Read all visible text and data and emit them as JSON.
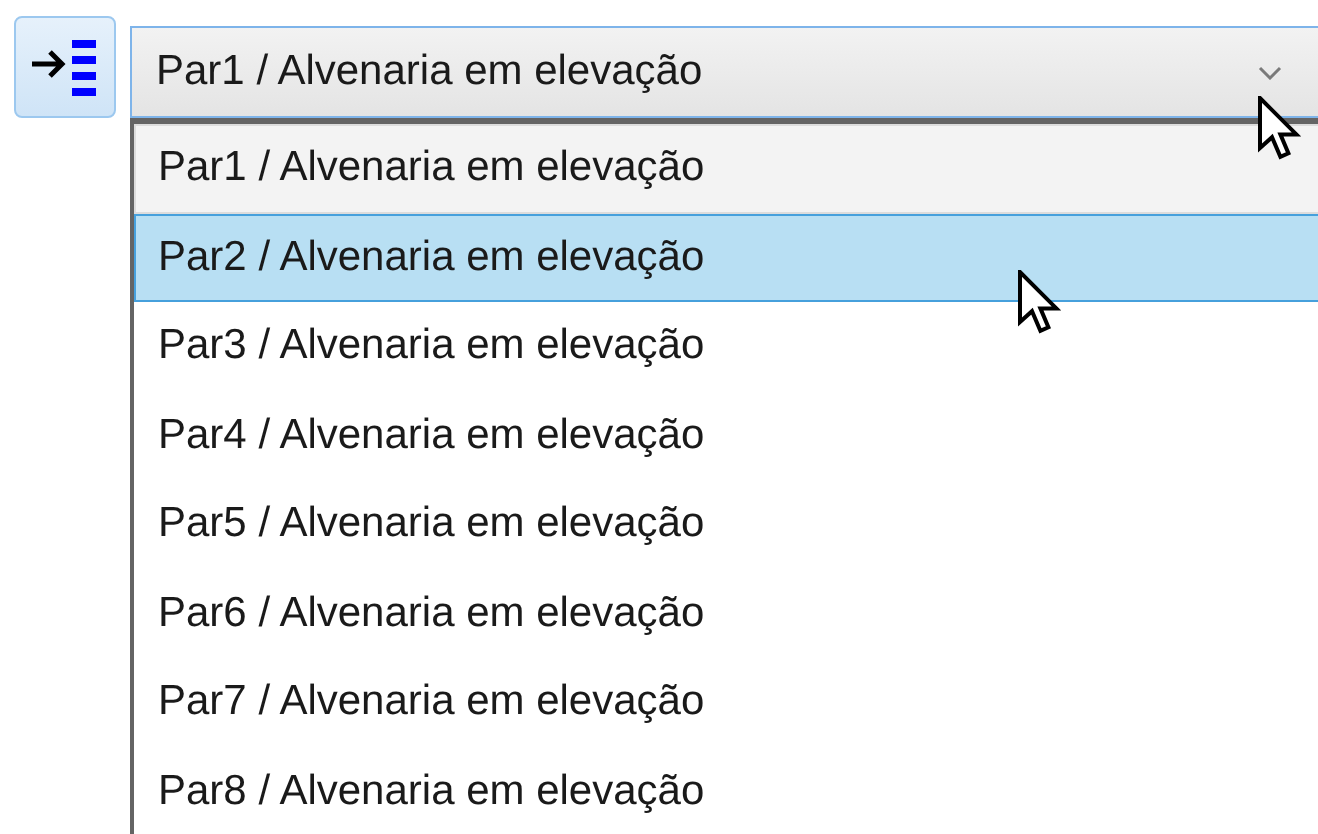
{
  "combo": {
    "value": "Par1 / Alvenaria em elevação",
    "expanded": true
  },
  "options": [
    {
      "label": "Par1 / Alvenaria em elevação",
      "current": true,
      "selected": false
    },
    {
      "label": "Par2 / Alvenaria em elevação",
      "current": false,
      "selected": true
    },
    {
      "label": "Par3 / Alvenaria em elevação",
      "current": false,
      "selected": false
    },
    {
      "label": "Par4 / Alvenaria em elevação",
      "current": false,
      "selected": false
    },
    {
      "label": "Par5 / Alvenaria em elevação",
      "current": false,
      "selected": false
    },
    {
      "label": "Par6 / Alvenaria em elevação",
      "current": false,
      "selected": false
    },
    {
      "label": "Par7 / Alvenaria em elevação",
      "current": false,
      "selected": false
    },
    {
      "label": "Par8 / Alvenaria em elevação",
      "current": false,
      "selected": false
    }
  ]
}
